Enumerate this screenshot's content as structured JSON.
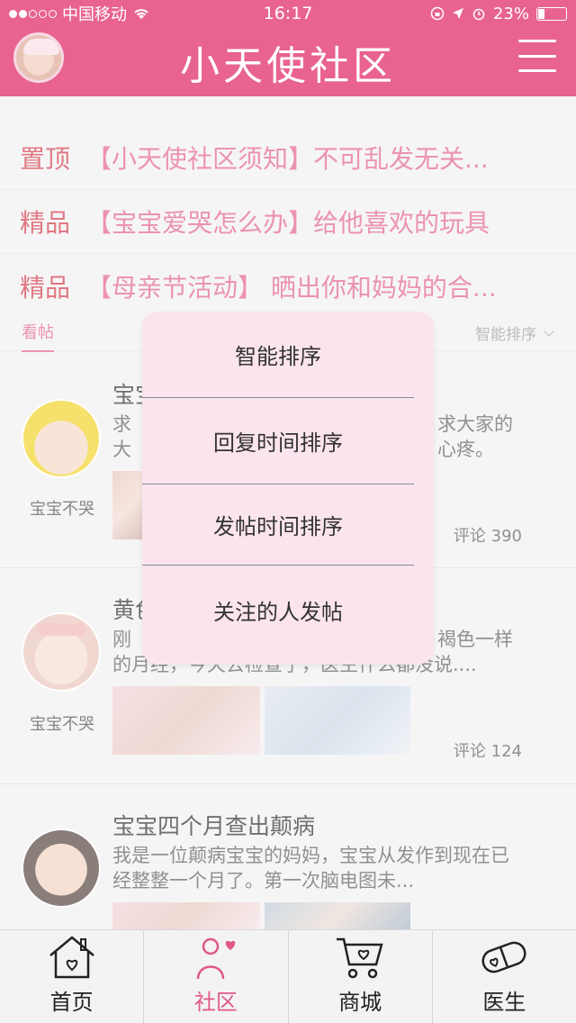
{
  "status_bar": {
    "carrier": "中国移动",
    "time": "16:17",
    "battery": "23%"
  },
  "header": {
    "title": "小天使社区"
  },
  "notices": [
    {
      "tag": "置顶",
      "text": "【小天使社区须知】不可乱发无关..."
    },
    {
      "tag": "精品",
      "text": "【宝宝爱哭怎么办】给他喜欢的玩具"
    },
    {
      "tag": "精品",
      "text": "【母亲节活动】 晒出你和妈妈的合..."
    }
  ],
  "tabs_row": {
    "tab_label": "看帖",
    "sort_label": "智能排序"
  },
  "posts": [
    {
      "user": "宝宝不哭",
      "title": "宝宝",
      "body_left": "求大\n帮助",
      "body_right": "求大家的\n心疼。",
      "comments": "评论 390"
    },
    {
      "user": "宝宝不哭",
      "title": "黄色",
      "body_left": "刚刚",
      "body_right": "褐色一样",
      "body_line2": "的月经，今天去检查了，医生什么都没说....",
      "comments": "评论 124"
    },
    {
      "user": "",
      "title": "宝宝四个月查出颠病",
      "body": "我是一位颠病宝宝的妈妈，宝宝从发作到现在已经整整一个月了。第一次脑电图未...",
      "comments": ""
    }
  ],
  "dropdown": {
    "items": [
      "智能排序",
      "回复时间排序",
      "发帖时间排序",
      "关注的人发帖"
    ]
  },
  "tabbar": {
    "items": [
      {
        "label": "首页",
        "icon": "home-icon"
      },
      {
        "label": "社区",
        "icon": "community-icon"
      },
      {
        "label": "商城",
        "icon": "cart-icon"
      },
      {
        "label": "医生",
        "icon": "pill-icon"
      }
    ],
    "active_color": "#e0588a"
  },
  "colors": {
    "brand": "#e8638f",
    "tag_red": "#d0313f",
    "dropdown_bg": "#fbe4ee"
  }
}
